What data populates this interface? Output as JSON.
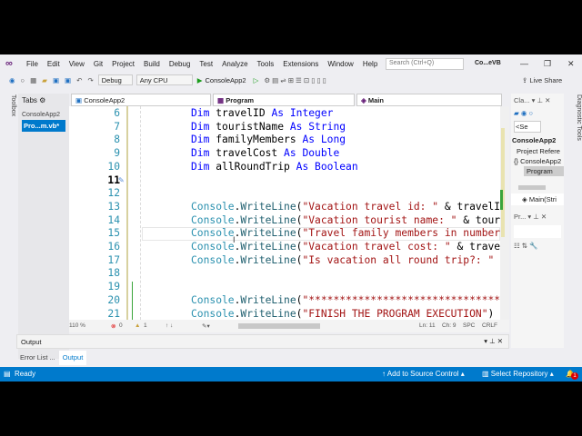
{
  "menu": {
    "items": [
      "File",
      "Edit",
      "View",
      "Git",
      "Project",
      "Build",
      "Debug",
      "Test",
      "Analyze",
      "Tools",
      "Extensions",
      "Window",
      "Help"
    ],
    "search_placeholder": "Search (Ctrl+Q)",
    "title": "Co...eVB"
  },
  "toolbar": {
    "config": "Debug",
    "platform": "Any CPU",
    "run_label": "ConsoleApp2",
    "live_share": "Live Share"
  },
  "side": {
    "toolbox": "Toolbox",
    "diagnostic": "Diagnostic Tools"
  },
  "tabs_panel": {
    "header": "Tabs",
    "project": "ConsoleApp2",
    "file": "Pro...m.vb*"
  },
  "nav": {
    "project": "ConsoleApp2",
    "class": "Program",
    "member": "Main"
  },
  "code": [
    {
      "n": "6",
      "t": [
        [
          "Dim ",
          "kw"
        ],
        [
          "travelID ",
          "plain"
        ],
        [
          "As Integer",
          "kw"
        ]
      ]
    },
    {
      "n": "7",
      "t": [
        [
          "Dim ",
          "kw"
        ],
        [
          "touristName ",
          "plain"
        ],
        [
          "As String",
          "kw"
        ]
      ]
    },
    {
      "n": "8",
      "t": [
        [
          "Dim ",
          "kw"
        ],
        [
          "familyMembers ",
          "plain"
        ],
        [
          "As Long",
          "kw"
        ]
      ]
    },
    {
      "n": "9",
      "t": [
        [
          "Dim ",
          "kw"
        ],
        [
          "travelCost ",
          "plain"
        ],
        [
          "As Double",
          "kw"
        ]
      ]
    },
    {
      "n": "10",
      "t": [
        [
          "Dim ",
          "kw"
        ],
        [
          "allRoundTrip ",
          "plain"
        ],
        [
          "As Boolean",
          "kw"
        ]
      ]
    },
    {
      "n": "11",
      "t": []
    },
    {
      "n": "12",
      "t": []
    },
    {
      "n": "13",
      "t": [
        [
          "Console",
          "cls"
        ],
        [
          ".",
          "plain"
        ],
        [
          "WriteLine",
          "meth"
        ],
        [
          "(",
          "plain"
        ],
        [
          "\"Vacation travel id: \"",
          "str"
        ],
        [
          " & travelID",
          "plain"
        ]
      ]
    },
    {
      "n": "14",
      "t": [
        [
          "Console",
          "cls"
        ],
        [
          ".",
          "plain"
        ],
        [
          "WriteLine",
          "meth"
        ],
        [
          "(",
          "plain"
        ],
        [
          "\"Vacation tourist name: \"",
          "str"
        ],
        [
          " & touristName",
          "plain"
        ]
      ]
    },
    {
      "n": "15",
      "t": [
        [
          "Console",
          "cls"
        ],
        [
          ".",
          "plain"
        ],
        [
          "WriteLine",
          "meth"
        ],
        [
          "(",
          "plain"
        ],
        [
          "\"Travel family members in number",
          "str"
        ]
      ]
    },
    {
      "n": "16",
      "t": [
        [
          "Console",
          "cls"
        ],
        [
          ".",
          "plain"
        ],
        [
          "WriteLine",
          "meth"
        ],
        [
          "(",
          "plain"
        ],
        [
          "\"Vacation travel cost: \"",
          "str"
        ],
        [
          " & travelCost",
          "plain"
        ]
      ]
    },
    {
      "n": "17",
      "t": [
        [
          "Console",
          "cls"
        ],
        [
          ".",
          "plain"
        ],
        [
          "WriteLine",
          "meth"
        ],
        [
          "(",
          "plain"
        ],
        [
          "\"Is vacation all round trip?: \"",
          "str"
        ]
      ]
    },
    {
      "n": "18",
      "t": []
    },
    {
      "n": "19",
      "t": []
    },
    {
      "n": "20",
      "t": [
        [
          "Console",
          "cls"
        ],
        [
          ".",
          "plain"
        ],
        [
          "WriteLine",
          "meth"
        ],
        [
          "(",
          "plain"
        ],
        [
          "\"*************************************",
          "str"
        ]
      ]
    },
    {
      "n": "21",
      "t": [
        [
          "Console",
          "cls"
        ],
        [
          ".",
          "plain"
        ],
        [
          "WriteLine",
          "meth"
        ],
        [
          "(",
          "plain"
        ],
        [
          "\"FINISH THE PROGRAM EXECUTION\"",
          "str"
        ],
        [
          ")",
          "plain"
        ]
      ]
    }
  ],
  "editor_status": {
    "zoom": "110 %",
    "errors": "0",
    "warnings": "1",
    "ln": "Ln: 11",
    "ch": "Ch: 9",
    "spc": "SPC",
    "crlf": "CRLF"
  },
  "output": {
    "title": "Output"
  },
  "bottom_tabs": [
    "Error List ...",
    "Output"
  ],
  "status": {
    "ready": "Ready",
    "source_control": "Add to Source Control",
    "repo": "Select Repository",
    "notifications": "1"
  },
  "classview": {
    "title": "Cla...",
    "search": "<Se",
    "root": "ConsoleApp2",
    "items": [
      "Project Refere",
      "ConsoleApp2",
      "Program"
    ],
    "member": "Main(Stri",
    "props_title": "Pr..."
  },
  "colors": {
    "accent": "#007acc",
    "keyword": "#0000ff",
    "string": "#a31515",
    "class": "#2b91af"
  }
}
